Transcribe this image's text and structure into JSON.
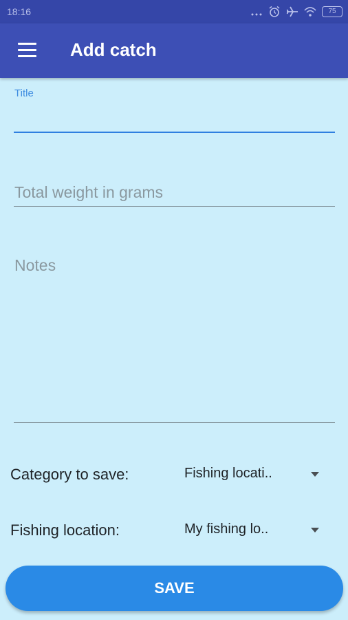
{
  "status_bar": {
    "time": "18:16",
    "battery_level": "75",
    "icons": [
      "more-dots-icon",
      "alarm-icon",
      "airplane-icon",
      "wifi-icon",
      "battery-icon"
    ]
  },
  "app_bar": {
    "title": "Add catch",
    "menu_icon": "hamburger-menu-icon"
  },
  "form": {
    "title_field": {
      "label": "Title",
      "value": ""
    },
    "weight_field": {
      "placeholder": "Total weight in grams",
      "value": ""
    },
    "notes_field": {
      "placeholder": "Notes",
      "value": ""
    },
    "category": {
      "label": "Category to save:",
      "selected": "Fishing locati.."
    },
    "location": {
      "label": "Fishing location:",
      "selected": "My fishing lo.."
    },
    "save_label": "SAVE"
  },
  "colors": {
    "status_bar": "#3546a8",
    "app_bar": "#3d4fb5",
    "background": "#cceefb",
    "accent": "#2a8ae6"
  }
}
